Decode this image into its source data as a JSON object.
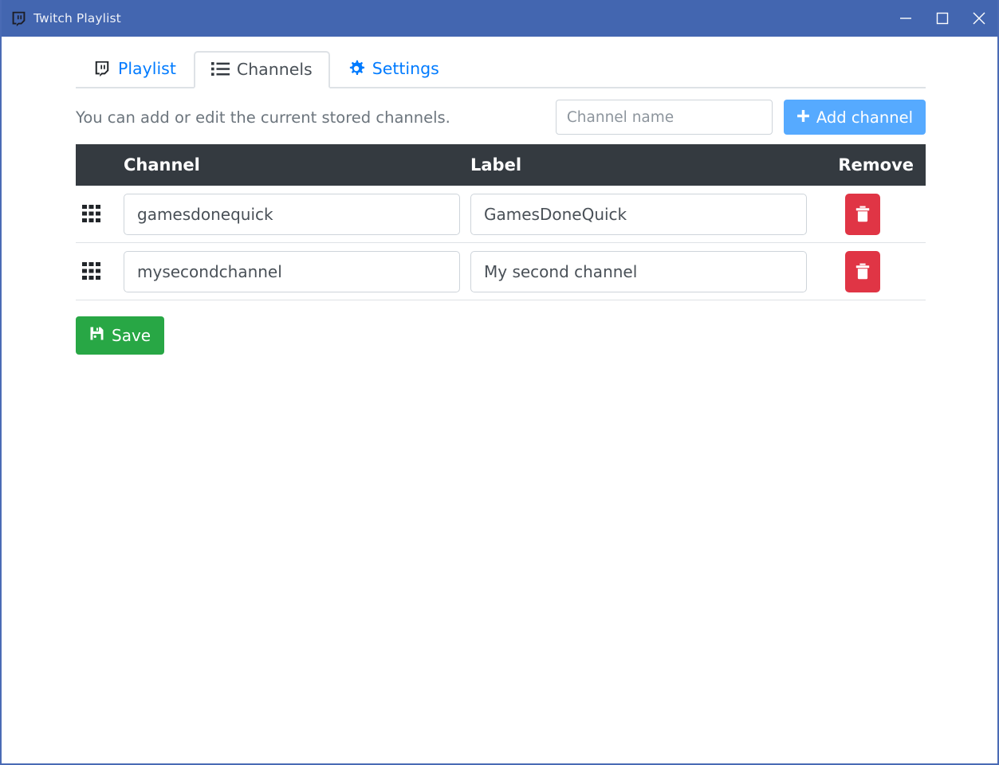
{
  "window": {
    "title": "Twitch Playlist",
    "icon": "twitch-logo-icon",
    "titlebar_color": "#4366b0",
    "controls": {
      "minimize": "minimize-icon",
      "maximize": "maximize-icon",
      "close": "close-icon"
    }
  },
  "tabs": [
    {
      "label": "Playlist",
      "icon": "twitch-logo-icon",
      "active": false
    },
    {
      "label": "Channels",
      "icon": "list-icon",
      "active": true
    },
    {
      "label": "Settings",
      "icon": "gear-icon",
      "active": false
    }
  ],
  "channels_panel": {
    "description": "You can add or edit the current stored channels.",
    "add_form": {
      "input_value": "",
      "input_placeholder": "Channel name",
      "button_label": "Add channel",
      "button_icon": "plus-icon",
      "button_color": "#56aaff"
    },
    "table": {
      "headers": {
        "drag": "",
        "channel": "Channel",
        "label": "Label",
        "remove": "Remove"
      },
      "header_bg": "#343a40",
      "rows": [
        {
          "handle_icon": "drag-grid-icon",
          "channel": "gamesdonequick",
          "label": "GamesDoneQuick",
          "remove_icon": "trash-icon",
          "remove_color": "#e03545"
        },
        {
          "handle_icon": "drag-grid-icon",
          "channel": "mysecondchannel",
          "label": "My second channel",
          "remove_icon": "trash-icon",
          "remove_color": "#e03545"
        }
      ]
    },
    "save": {
      "label": "Save",
      "icon": "floppy-save-icon",
      "color": "#28a745"
    }
  }
}
